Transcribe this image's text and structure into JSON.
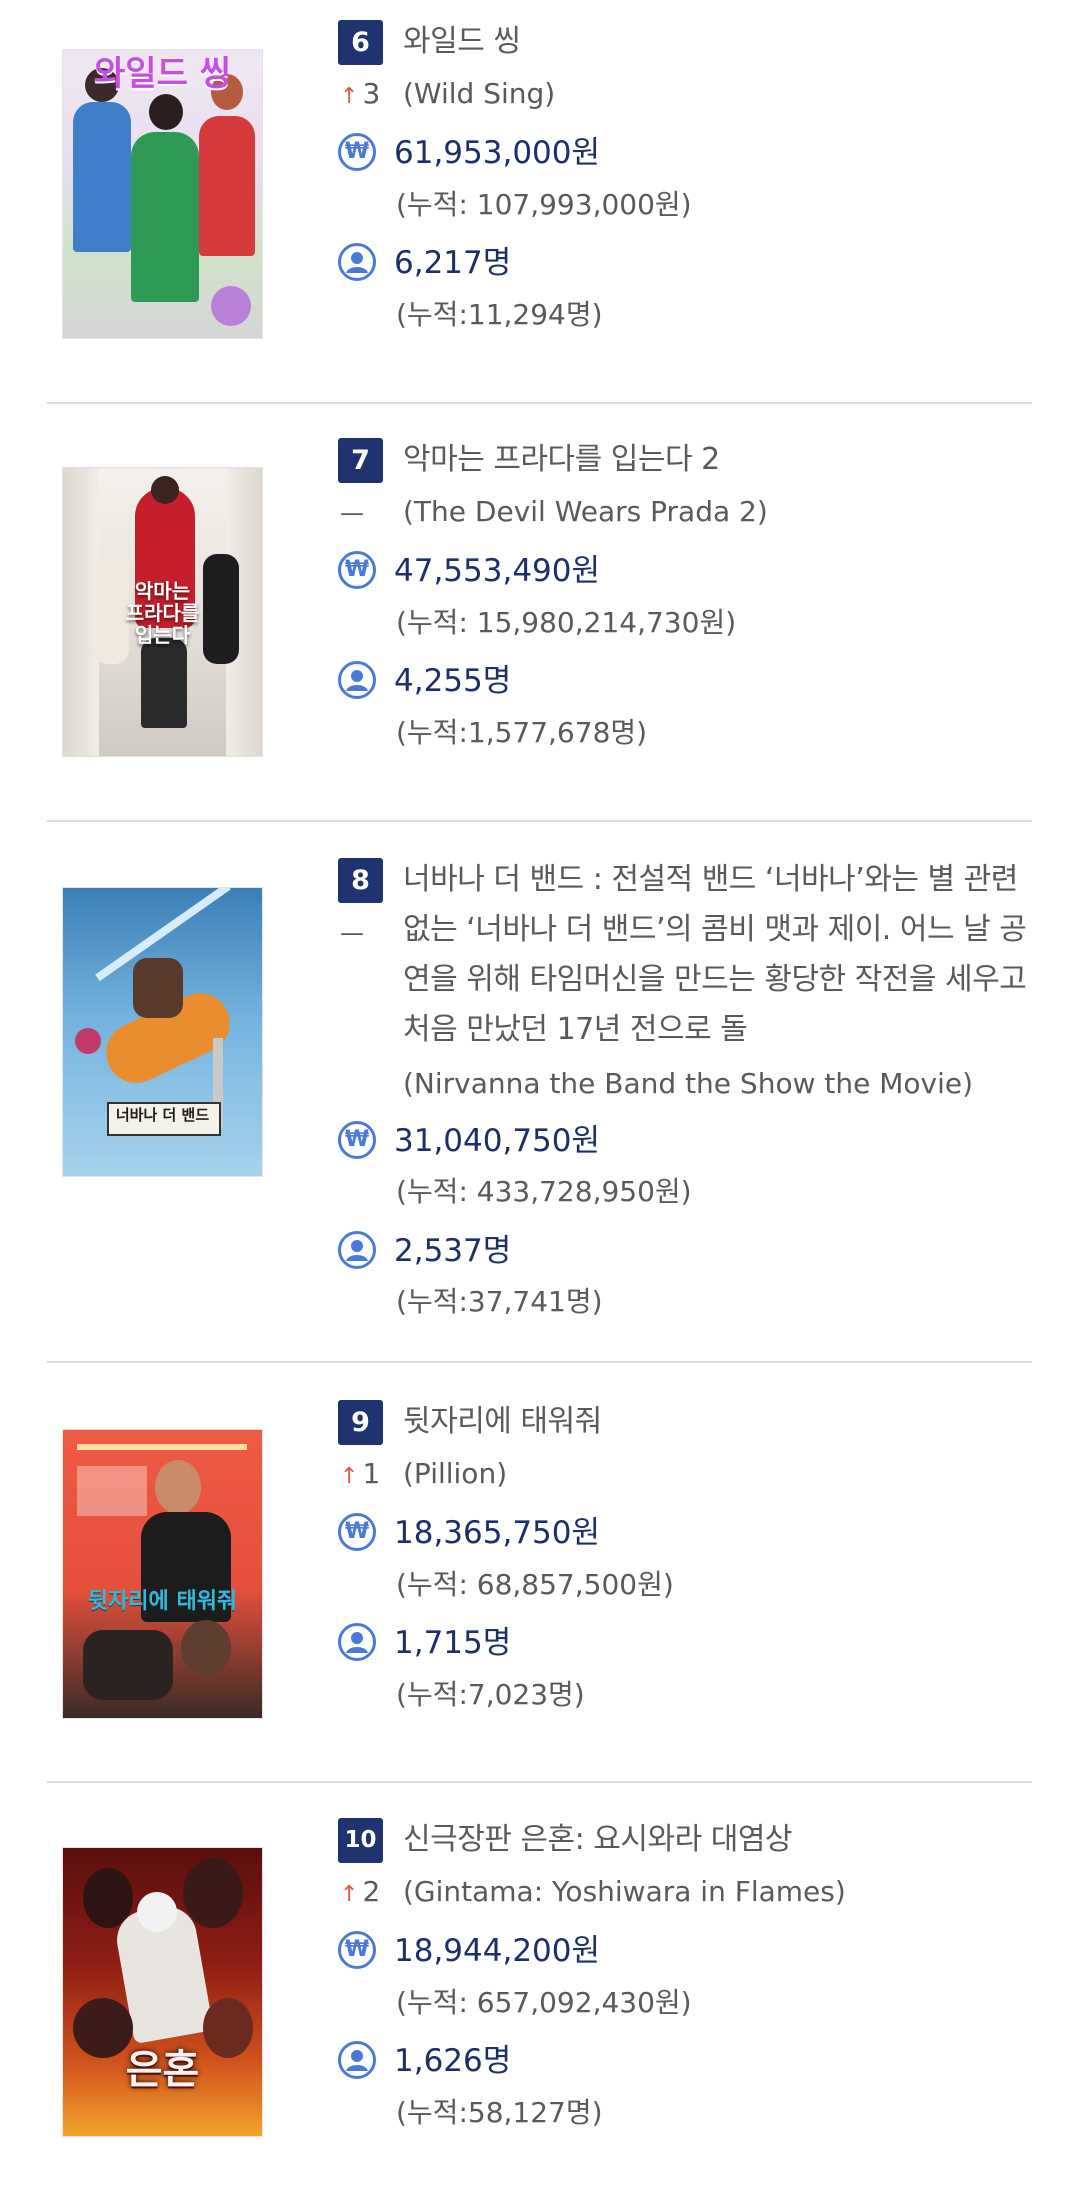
{
  "movies": [
    {
      "rank": "6",
      "title_kr": "와일드 씽",
      "change": {
        "direction": "up",
        "symbol": "↑",
        "value": "3"
      },
      "title_en": "(Wild Sing)",
      "revenue": "61,953,000원",
      "revenue_cum": "(누적: 107,993,000원)",
      "audience": "6,217명",
      "audience_cum": "(누적:11,294명)",
      "poster_text": "와일드 씽",
      "poster_colors": [
        "#e9e3ee",
        "#b94bd4",
        "#d9343a"
      ]
    },
    {
      "rank": "7",
      "title_kr": "악마는 프라다를 입는다 2",
      "change": {
        "direction": "none",
        "symbol": "—",
        "value": ""
      },
      "title_en": "(The Devil Wears Prada 2)",
      "revenue": "47,553,490원",
      "revenue_cum": "(누적: 15,980,214,730원)",
      "audience": "4,255명",
      "audience_cum": "(누적:1,577,678명)",
      "poster_text": "악마는 프라다를 입는다",
      "poster_colors": [
        "#f1eeea",
        "#c7c2bb",
        "#c1202a"
      ]
    },
    {
      "rank": "8",
      "title_kr": "너바나 더 밴드 : 전설적 밴드 ‘너바나’와는 별 관련 없는 ‘너바나 더 밴드’의 콤비 맷과 제이. 어느 날 공연을 위해 타임머신을 만드는 황당한 작전을 세우고 처음 만났던 17년 전으로 돌",
      "change": {
        "direction": "none",
        "symbol": "—",
        "value": ""
      },
      "title_en": "(Nirvanna the Band the Show the Movie)",
      "revenue": "31,040,750원",
      "revenue_cum": "(누적: 433,728,950원)",
      "audience": "2,537명",
      "audience_cum": "(누적:37,741명)",
      "poster_text": "너바나 더 밴드",
      "poster_colors": [
        "#5fa2d2",
        "#3a7fb8",
        "#e68a2e"
      ]
    },
    {
      "rank": "9",
      "title_kr": "뒷자리에 태워줘",
      "change": {
        "direction": "up",
        "symbol": "↑",
        "value": "1"
      },
      "title_en": "(Pillion)",
      "revenue": "18,365,750원",
      "revenue_cum": "(누적: 68,857,500원)",
      "audience": "1,715명",
      "audience_cum": "(누적:7,023명)",
      "poster_text": "뒷자리에 태워줘",
      "poster_colors": [
        "#ef5a45",
        "#d8442f",
        "#2a1d1a"
      ]
    },
    {
      "rank": "10",
      "title_kr": "신극장판 은혼: 요시와라 대염상",
      "change": {
        "direction": "up",
        "symbol": "↑",
        "value": "2"
      },
      "title_en": "(Gintama: Yoshiwara in Flames)",
      "revenue": "18,944,200원",
      "revenue_cum": "(누적: 657,092,430원)",
      "audience": "1,626명",
      "audience_cum": "(누적:58,127명)",
      "poster_text": "은혼",
      "poster_colors": [
        "#7a1712",
        "#c43a1a",
        "#f0a32a"
      ]
    }
  ],
  "icons": {
    "revenue": "won-icon",
    "audience": "person-icon"
  },
  "colors": {
    "badge": "#1e3370",
    "value_text": "#1c2f6b",
    "icon": "#4a7ad8",
    "up_arrow": "#e8553e",
    "divider": "#dcdcdc"
  }
}
